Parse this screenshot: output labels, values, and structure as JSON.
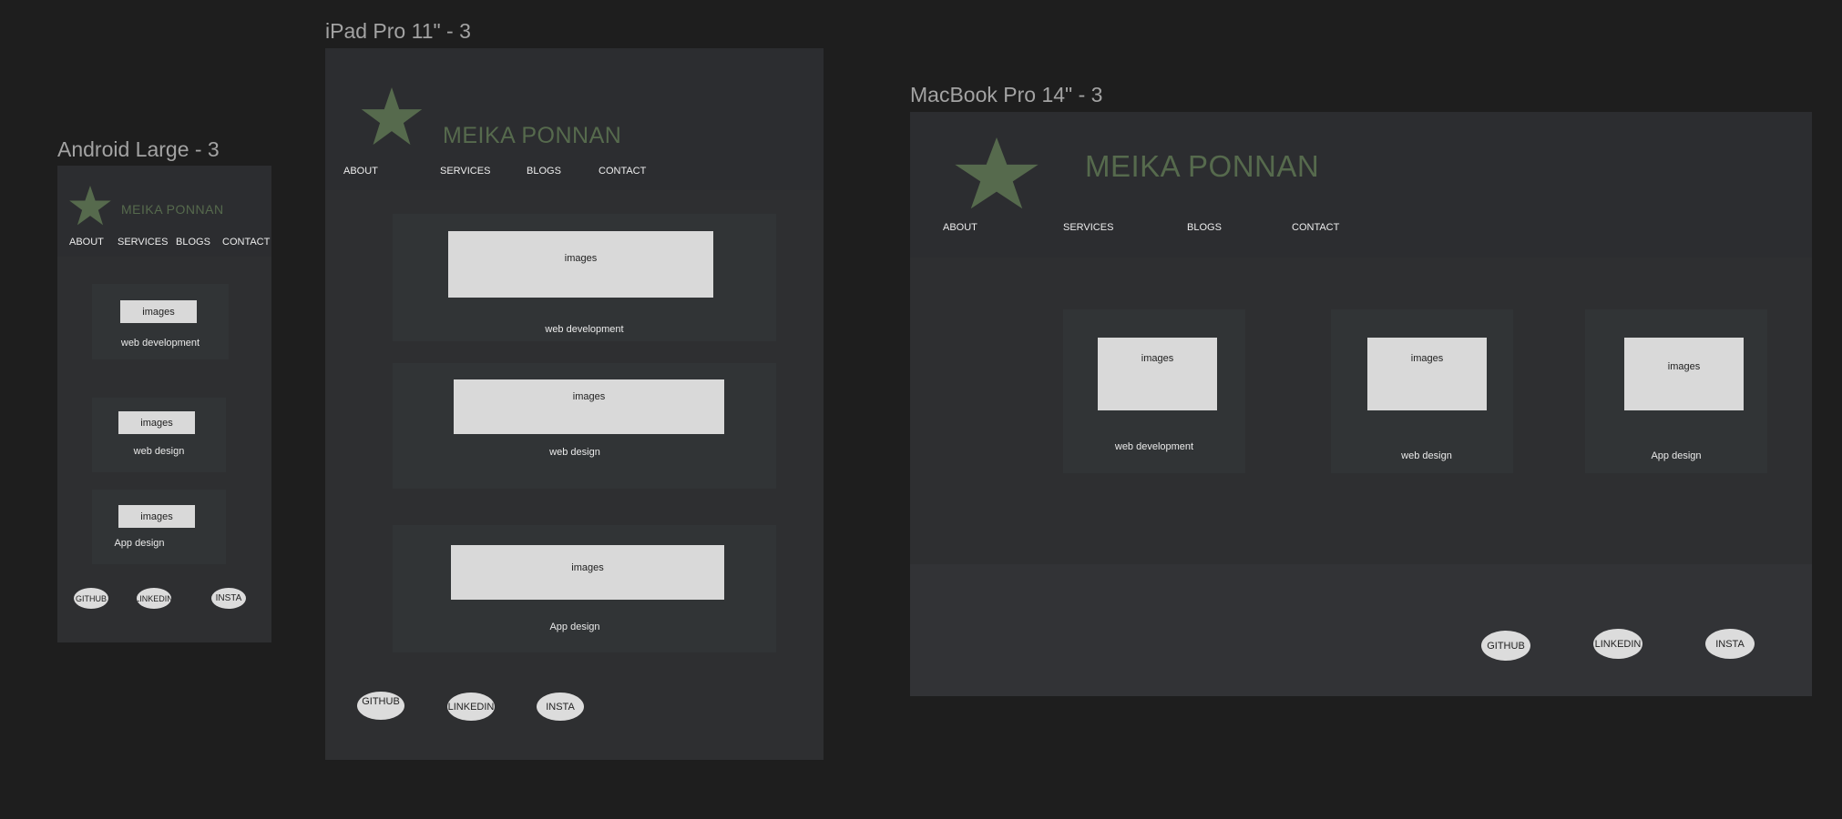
{
  "android": {
    "frame_title": "Android Large - 3",
    "brand": "MEIKA PONNAN",
    "nav": [
      "ABOUT",
      "SERVICES",
      "BLOGS",
      "CONTACT"
    ],
    "cards": [
      {
        "image_label": "images",
        "caption": "web development"
      },
      {
        "image_label": "images",
        "caption": "web design"
      },
      {
        "image_label": "images",
        "caption": "App design"
      }
    ],
    "social": [
      "GITHUB",
      "LINKEDIN",
      "INSTA"
    ]
  },
  "ipad": {
    "frame_title": "iPad Pro 11\" - 3",
    "brand": "MEIKA PONNAN",
    "nav": [
      "ABOUT",
      "SERVICES",
      "BLOGS",
      "CONTACT"
    ],
    "cards": [
      {
        "image_label": "images",
        "caption": "web development"
      },
      {
        "image_label": "images",
        "caption": "web design"
      },
      {
        "image_label": "images",
        "caption": "App design"
      }
    ],
    "social": [
      "GITHUB",
      "LINKEDIN",
      "INSTA"
    ]
  },
  "macbook": {
    "frame_title": "MacBook Pro 14\" - 3",
    "brand": "MEIKA PONNAN",
    "nav": [
      "ABOUT",
      "SERVICES",
      "BLOGS",
      "CONTACT"
    ],
    "cards": [
      {
        "image_label": "images",
        "caption": "web development"
      },
      {
        "image_label": "images",
        "caption": "web design"
      },
      {
        "image_label": "images",
        "caption": "App design"
      }
    ],
    "social": [
      "GITHUB",
      "LINKEDIN",
      "INSTA"
    ]
  },
  "colors": {
    "canvas_bg": "#1e1e1e",
    "frame_bg": "#2e2f31",
    "card_bg": "#313436",
    "brand_green": "#566a4d",
    "image_placeholder": "#d9d9d9"
  },
  "icons": {
    "logo": "star-icon"
  }
}
